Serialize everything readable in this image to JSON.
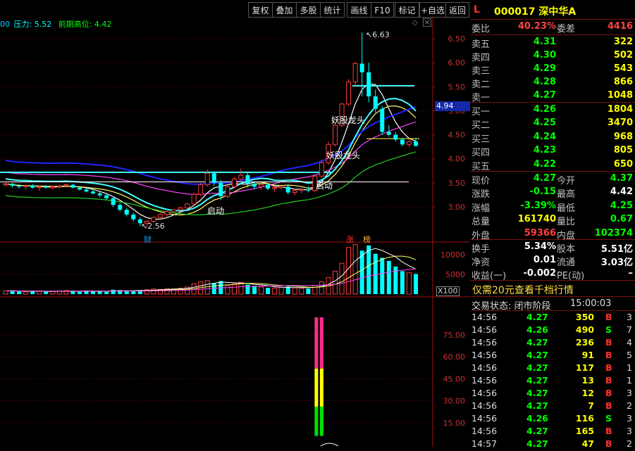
{
  "toolbar": {
    "buttons": [
      "复权",
      "叠加",
      "多股",
      "统计",
      "画线",
      "F10",
      "标记",
      "+自选",
      "返回"
    ]
  },
  "indicator": {
    "prefix": "00",
    "pressure_label": "压力: 5.52",
    "prev_high_label": "前期高位: 4.42"
  },
  "chart_labels": {
    "high": "6.63",
    "low": "2.56",
    "launch1": "启动",
    "launch2": "启动",
    "dragon1": "妖股龙头",
    "dragon2": "妖股龙头",
    "fin_badge": "财",
    "zhang_badge": "涨",
    "bang_badge": "榜",
    "price_tag": "4.94",
    "x100": "X100"
  },
  "axes": {
    "price_ticks": [
      "6.50",
      "6.00",
      "5.50",
      "5.00",
      "4.50",
      "4.00",
      "3.50",
      "3.00"
    ],
    "volume_ticks": [
      "10000",
      "5000"
    ],
    "osc_ticks": [
      "75.00",
      "60.00",
      "45.00",
      "30.00",
      "15.00"
    ]
  },
  "chart_data": [
    {
      "type": "candlestick",
      "title": "",
      "ylim": [
        2.3,
        6.8
      ],
      "candles": [
        [
          3.46,
          3.52,
          3.42,
          3.48
        ],
        [
          3.48,
          3.5,
          3.4,
          3.44
        ],
        [
          3.44,
          3.48,
          3.38,
          3.42
        ],
        [
          3.42,
          3.46,
          3.36,
          3.44
        ],
        [
          3.44,
          3.48,
          3.38,
          3.4
        ],
        [
          3.4,
          3.44,
          3.34,
          3.42
        ],
        [
          3.42,
          3.46,
          3.38,
          3.4
        ],
        [
          3.4,
          3.44,
          3.36,
          3.42
        ],
        [
          3.42,
          3.46,
          3.38,
          3.44
        ],
        [
          3.44,
          3.48,
          3.4,
          3.46
        ],
        [
          3.46,
          3.48,
          3.38,
          3.4
        ],
        [
          3.4,
          3.44,
          3.34,
          3.36
        ],
        [
          3.36,
          3.4,
          3.3,
          3.32
        ],
        [
          3.32,
          3.36,
          3.26,
          3.28
        ],
        [
          3.28,
          3.32,
          3.2,
          3.24
        ],
        [
          3.24,
          3.28,
          3.14,
          3.18
        ],
        [
          3.18,
          3.22,
          3.0,
          3.04
        ],
        [
          3.04,
          3.08,
          2.9,
          2.94
        ],
        [
          2.94,
          2.98,
          2.8,
          2.84
        ],
        [
          2.84,
          2.88,
          2.7,
          2.74
        ],
        [
          2.74,
          2.78,
          2.6,
          2.66
        ],
        [
          2.66,
          2.72,
          2.56,
          2.7
        ],
        [
          2.7,
          2.8,
          2.66,
          2.78
        ],
        [
          2.78,
          2.86,
          2.74,
          2.84
        ],
        [
          2.84,
          2.92,
          2.8,
          2.9
        ],
        [
          2.9,
          2.96,
          2.86,
          2.94
        ],
        [
          2.94,
          3.0,
          2.9,
          2.98
        ],
        [
          2.98,
          3.08,
          2.94,
          3.06
        ],
        [
          3.06,
          3.3,
          3.02,
          3.26
        ],
        [
          3.26,
          3.5,
          3.22,
          3.46
        ],
        [
          3.46,
          3.78,
          3.42,
          3.7
        ],
        [
          3.7,
          3.74,
          3.44,
          3.5
        ],
        [
          3.5,
          3.56,
          3.14,
          3.22
        ],
        [
          3.22,
          3.46,
          3.18,
          3.42
        ],
        [
          3.42,
          3.62,
          3.38,
          3.58
        ],
        [
          3.58,
          3.8,
          3.54,
          3.66
        ],
        [
          3.66,
          3.72,
          3.4,
          3.48
        ],
        [
          3.48,
          3.52,
          3.36,
          3.42
        ],
        [
          3.42,
          3.5,
          3.36,
          3.46
        ],
        [
          3.46,
          3.5,
          3.34,
          3.38
        ],
        [
          3.38,
          3.44,
          3.32,
          3.4
        ],
        [
          3.4,
          3.46,
          3.36,
          3.42
        ],
        [
          3.42,
          3.44,
          3.26,
          3.3
        ],
        [
          3.3,
          3.38,
          3.24,
          3.34
        ],
        [
          3.34,
          3.4,
          3.28,
          3.36
        ],
        [
          3.36,
          3.42,
          3.3,
          3.34
        ],
        [
          3.34,
          3.68,
          3.3,
          3.64
        ],
        [
          3.64,
          3.98,
          3.6,
          3.92
        ],
        [
          3.92,
          4.36,
          3.88,
          4.3
        ],
        [
          4.3,
          4.74,
          4.26,
          4.7
        ],
        [
          4.7,
          5.16,
          4.66,
          5.14
        ],
        [
          5.14,
          5.66,
          5.1,
          5.6
        ],
        [
          5.6,
          6.02,
          5.5,
          5.98
        ],
        [
          5.98,
          6.63,
          5.3,
          5.8
        ],
        [
          5.8,
          6.0,
          5.18,
          5.3
        ],
        [
          5.3,
          5.44,
          4.96,
          5.04
        ],
        [
          5.04,
          5.1,
          4.5,
          4.56
        ],
        [
          4.56,
          4.7,
          4.46,
          4.5
        ],
        [
          4.5,
          4.56,
          4.36,
          4.4
        ],
        [
          4.4,
          4.44,
          4.26,
          4.3
        ],
        [
          4.3,
          4.4,
          4.24,
          4.36
        ],
        [
          4.36,
          4.42,
          4.25,
          4.27
        ]
      ],
      "series": []
    },
    {
      "type": "bar",
      "title": "",
      "ylim": [
        0,
        13000
      ],
      "values": [
        800,
        900,
        700,
        600,
        800,
        700,
        600,
        700,
        800,
        900,
        700,
        600,
        900,
        800,
        700,
        600,
        1100,
        1000,
        900,
        800,
        900,
        1100,
        1300,
        1200,
        1400,
        1300,
        1500,
        1800,
        2600,
        3100,
        3400,
        2800,
        3300,
        2200,
        2600,
        3000,
        2400,
        2000,
        1800,
        1600,
        1500,
        1700,
        1900,
        1600,
        1500,
        1400,
        2200,
        3100,
        4200,
        5800,
        7800,
        11800,
        12500,
        11000,
        12300,
        10200,
        9200,
        8400,
        7000,
        5800,
        5400,
        5100
      ]
    },
    {
      "type": "bar",
      "title": "",
      "ylim": [
        0,
        100
      ],
      "values": [
        0,
        0,
        0,
        0,
        0,
        0,
        0,
        0,
        0,
        0,
        0,
        0,
        0,
        0,
        0,
        0,
        0,
        0,
        0,
        0,
        0,
        0,
        0,
        0,
        0,
        0,
        0,
        0,
        0,
        0,
        0,
        0,
        0,
        0,
        0,
        0,
        0,
        0,
        0,
        0,
        0,
        0,
        0,
        0,
        0,
        0,
        0,
        0,
        0,
        0,
        0,
        0,
        0,
        0,
        0,
        0,
        0,
        0,
        0,
        0,
        0,
        0
      ]
    }
  ],
  "stock": {
    "tag": "L",
    "code_name": "000017 深中华A"
  },
  "ratio": {
    "label": "委比",
    "value": "40.23%",
    "label2": "委差",
    "value2": "4416"
  },
  "sells": [
    {
      "label": "卖五",
      "price": "4.31",
      "vol": "322"
    },
    {
      "label": "卖四",
      "price": "4.30",
      "vol": "502"
    },
    {
      "label": "卖三",
      "price": "4.29",
      "vol": "543"
    },
    {
      "label": "卖二",
      "price": "4.28",
      "vol": "866"
    },
    {
      "label": "卖一",
      "price": "4.27",
      "vol": "1048"
    }
  ],
  "buys": [
    {
      "label": "买一",
      "price": "4.26",
      "vol": "1804"
    },
    {
      "label": "买二",
      "price": "4.25",
      "vol": "3470"
    },
    {
      "label": "买三",
      "price": "4.24",
      "vol": "968"
    },
    {
      "label": "买四",
      "price": "4.23",
      "vol": "805"
    },
    {
      "label": "买五",
      "price": "4.22",
      "vol": "650"
    }
  ],
  "quote": [
    {
      "l1": "现价",
      "v1": "4.27",
      "l2": "今开",
      "v2": "4.37",
      "c1": "#00ff00",
      "c2": "#00ff00"
    },
    {
      "l1": "涨跌",
      "v1": "-0.15",
      "l2": "最高",
      "v2": "4.42",
      "c1": "#00ff00",
      "c2": "#ffffff"
    },
    {
      "l1": "涨幅",
      "v1": "-3.39%",
      "l2": "最低",
      "v2": "4.25",
      "c1": "#00ff00",
      "c2": "#00ff00"
    },
    {
      "l1": "总量",
      "v1": "161740",
      "l2": "量比",
      "v2": "0.67",
      "c1": "#ffff00",
      "c2": "#00ff00"
    },
    {
      "l1": "外盘",
      "v1": "59366",
      "l2": "内盘",
      "v2": "102374",
      "c1": "#ff4040",
      "c2": "#00ff00"
    }
  ],
  "fund": [
    {
      "l1": "换手",
      "v1": "5.34%",
      "l2": "股本",
      "v2": "5.51亿"
    },
    {
      "l1": "净资",
      "v1": "0.01",
      "l2": "流通",
      "v2": "3.03亿"
    },
    {
      "l1": "收益(一)",
      "v1": "-0.002",
      "l2": "PE(动)",
      "v2": "–"
    }
  ],
  "promo": "仅需20元查看千档行情",
  "trade_status": {
    "label": "交易状态: 闭市阶段",
    "time": "15:00:03"
  },
  "ticks": [
    {
      "t": "14:56",
      "p": "4.27",
      "v": "350",
      "s": "B",
      "n": "3"
    },
    {
      "t": "14:56",
      "p": "4.26",
      "v": "490",
      "s": "S",
      "n": "7"
    },
    {
      "t": "14:56",
      "p": "4.27",
      "v": "236",
      "s": "B",
      "n": "4"
    },
    {
      "t": "14:56",
      "p": "4.27",
      "v": "91",
      "s": "B",
      "n": "5"
    },
    {
      "t": "14:56",
      "p": "4.27",
      "v": "117",
      "s": "B",
      "n": "1"
    },
    {
      "t": "14:56",
      "p": "4.27",
      "v": "13",
      "s": "B",
      "n": "1"
    },
    {
      "t": "14:56",
      "p": "4.27",
      "v": "12",
      "s": "B",
      "n": "3"
    },
    {
      "t": "14:56",
      "p": "4.27",
      "v": "7",
      "s": "B",
      "n": "2"
    },
    {
      "t": "14:56",
      "p": "4.26",
      "v": "116",
      "s": "S",
      "n": "3"
    },
    {
      "t": "14:56",
      "p": "4.27",
      "v": "165",
      "s": "B",
      "n": "3"
    },
    {
      "t": "14:57",
      "p": "4.27",
      "v": "47",
      "s": "B",
      "n": "2"
    }
  ]
}
